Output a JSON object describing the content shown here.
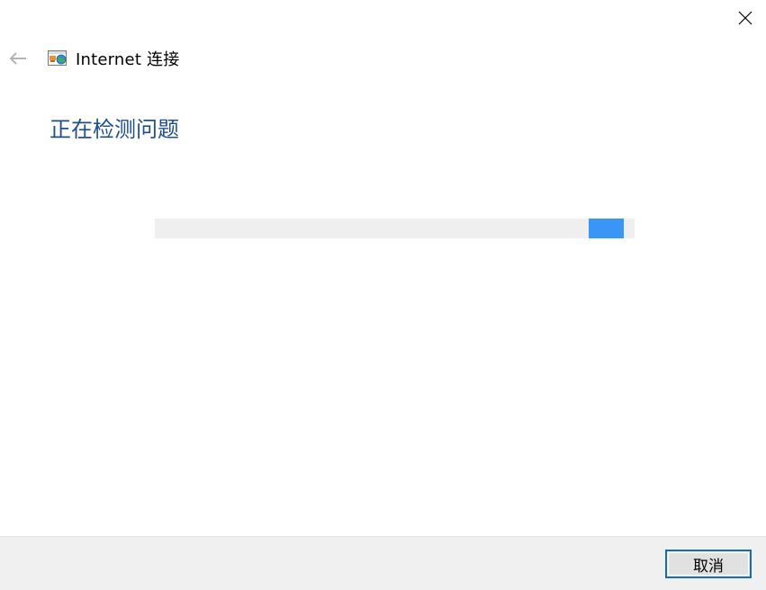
{
  "window": {
    "title": "Internet 连接",
    "app_icon": "network-connection-icon",
    "close_icon": "close-icon",
    "back_icon": "back-arrow-icon"
  },
  "main": {
    "heading": "正在检测问题",
    "progress": {
      "mode": "indeterminate",
      "indicator_start_fraction": 0.904,
      "indicator_width_fraction": 0.073
    }
  },
  "footer": {
    "cancel_label": "取消"
  },
  "colors": {
    "heading": "#1f4e93",
    "progress_track": "#efefef",
    "progress_indicator": "#3a96f5",
    "footer_background": "#f0f0f0",
    "button_border": "#1a6fa9"
  }
}
